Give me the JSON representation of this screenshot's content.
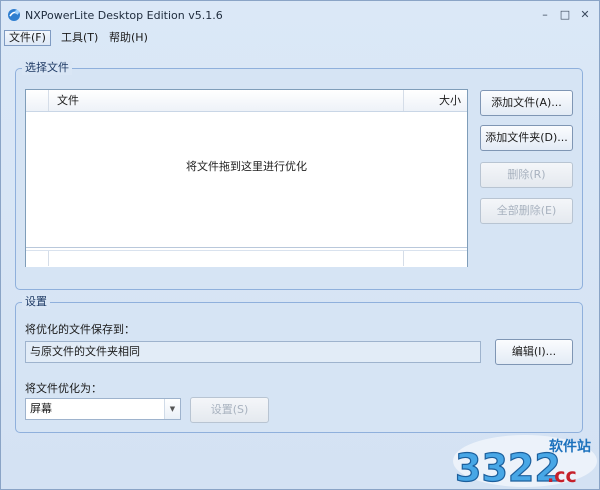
{
  "window": {
    "title": "NXPowerLite Desktop Edition v5.1.6",
    "controls": {
      "minimize": "–",
      "maximize": "□",
      "close": "✕"
    }
  },
  "menu": [
    {
      "label": "文件(F)",
      "active": true
    },
    {
      "label": "工具(T)",
      "active": false
    },
    {
      "label": "帮助(H)",
      "active": false
    }
  ],
  "select_files": {
    "group_label": "选择文件",
    "columns": {
      "file": "文件",
      "size": "大小"
    },
    "empty_hint": "将文件拖到这里进行优化",
    "buttons": {
      "add_file": "添加文件(A)...",
      "add_folder": "添加文件夹(D)...",
      "delete": "删除(R)",
      "delete_all": "全部删除(E)"
    }
  },
  "settings": {
    "group_label": "设置",
    "save_to_label": "将优化的文件保存到：",
    "save_to_value": "与原文件的文件夹相同",
    "edit_button": "编辑(I)...",
    "optimize_for_label": "将文件优化为：",
    "optimize_for_value": "屏幕",
    "settings_button": "设置(S)"
  },
  "watermark": {
    "main": "3322",
    "suffix": ".cc",
    "caption": "软件站"
  }
}
